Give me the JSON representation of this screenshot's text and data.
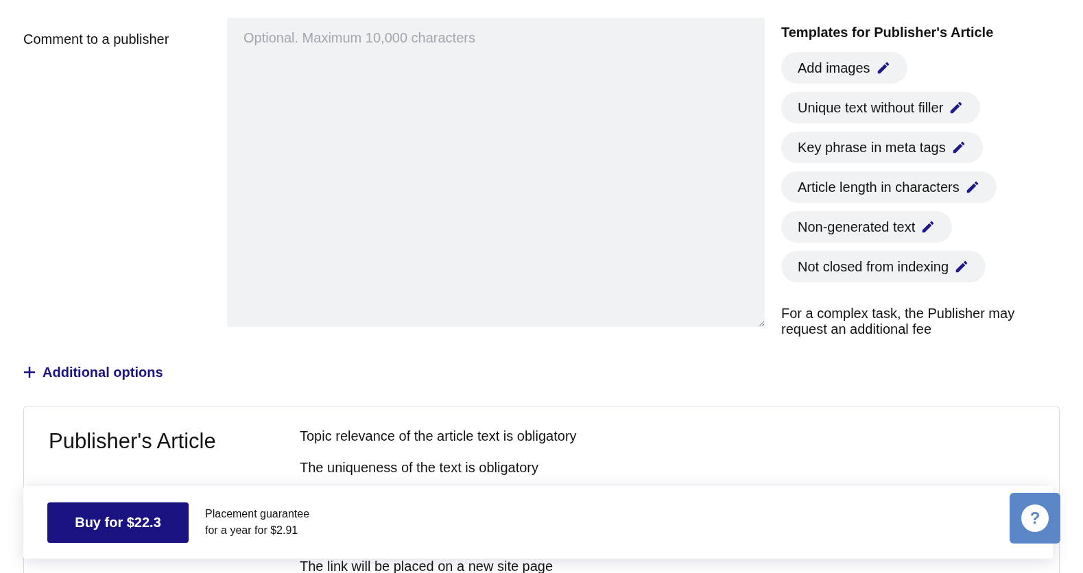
{
  "comment": {
    "label": "Comment to a publisher",
    "placeholder": "Optional. Maximum 10,000 characters"
  },
  "templates": {
    "title": "Templates for Publisher's Article",
    "items": [
      {
        "label": "Add images"
      },
      {
        "label": "Unique text without filler"
      },
      {
        "label": "Key phrase in meta tags"
      },
      {
        "label": "Article length in characters"
      },
      {
        "label": "Non-generated text"
      },
      {
        "label": "Not closed from indexing"
      }
    ],
    "note": "For a complex task, the Publisher may request an additional fee"
  },
  "additional_options": {
    "label": "Additional options",
    "expanded": false
  },
  "article_card": {
    "title": "Publisher's Article",
    "requirements": [
      "Topic relevance of the article text is obligatory",
      "The uniqueness of the text is obligatory",
      "The link will be placed on a new site page"
    ]
  },
  "purchase_bar": {
    "button": "Buy for $22.3",
    "guarantee": [
      "Placement guarantee",
      "for a year for $2.91"
    ]
  },
  "help_button": {
    "label": "?"
  }
}
